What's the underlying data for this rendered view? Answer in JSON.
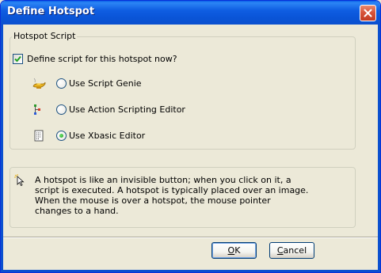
{
  "dialog": {
    "title": "Define Hotspot",
    "close_icon": "close-icon"
  },
  "group": {
    "legend": "Hotspot Script",
    "define_checkbox": {
      "label": "Define script for this hotspot now?",
      "checked": true
    },
    "options": [
      {
        "label": "Use Script Genie",
        "icon": "genie-lamp-icon",
        "selected": false
      },
      {
        "label": "Use Action Scripting Editor",
        "icon": "action-scripting-icon",
        "selected": false
      },
      {
        "label": "Use Xbasic Editor",
        "icon": "xbasic-editor-icon",
        "selected": true
      }
    ]
  },
  "info": {
    "icon": "pointer-hint-icon",
    "lines": [
      "A hotspot is like an invisible button; when you click on it, a",
      "script is executed. A hotspot is typically placed over an image.",
      "When the mouse is over a hotspot, the mouse pointer",
      "changes to a hand."
    ]
  },
  "buttons": {
    "ok": {
      "mnemonic": "O",
      "rest": "K"
    },
    "cancel": {
      "mnemonic": "C",
      "rest": "ancel"
    }
  },
  "colors": {
    "titlebar": "#0a55d8",
    "dialog_background": "#ece9d8",
    "radio_selected_dot": "#21a121",
    "checkbox_check": "#21a121"
  }
}
